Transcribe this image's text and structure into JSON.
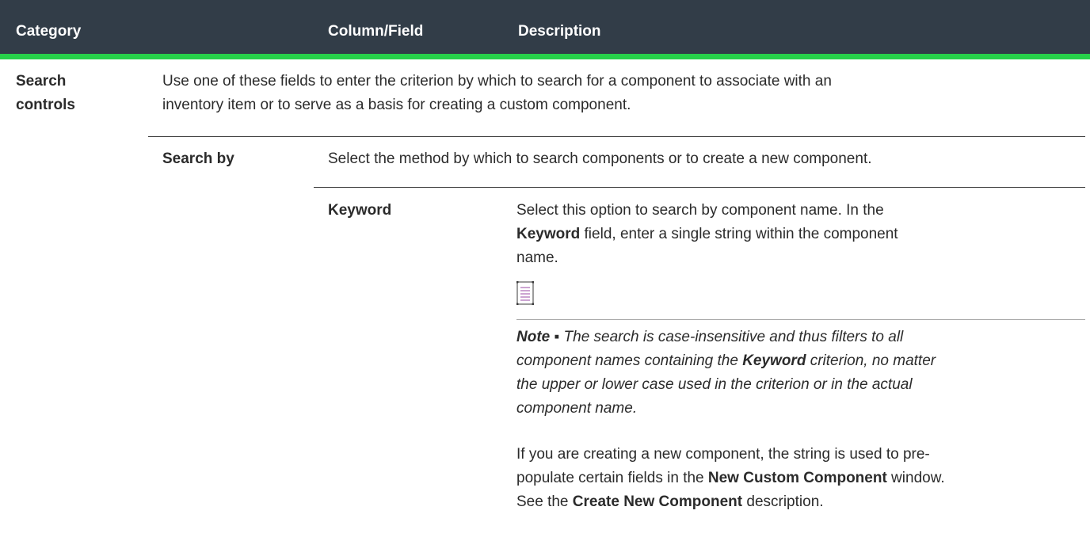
{
  "header": {
    "category": "Category",
    "column_field": "Column/Field",
    "description": "Description"
  },
  "row": {
    "category_line1": "Search",
    "category_line2": "controls",
    "description_line1": "Use one of these fields to enter the criterion by which to search for a component to associate with an",
    "description_line2": "inventory item or to serve as a basis for creating a custom component."
  },
  "search_by": {
    "label": "Search by",
    "description": "Select the method by which to search components or to create a new component."
  },
  "keyword": {
    "label": "Keyword",
    "desc_line1": "Select this option to search by component name. In the",
    "desc_line2_bold": "Keyword",
    "desc_line2_rest": " field, enter a single string within the component",
    "desc_line3": "name.",
    "note_icon": "note-icon",
    "note_prefix": "Note ▪",
    "note_line1_rest": " The search is case-insensitive and thus filters to all",
    "note_line2_a": "component names containing the ",
    "note_line2_bold": "Keyword",
    "note_line2_b": " criterion, no matter",
    "note_line3": "the upper or lower case used in the criterion or in the actual",
    "note_line4": "component name.",
    "para_line1": "If you are creating a new component, the string is used to pre-",
    "para_line2_a": "populate certain fields in the ",
    "para_line2_bold": "New Custom Component",
    "para_line2_b": " window.",
    "para_line3_a": "See the ",
    "para_line3_bold": "Create New Component",
    "para_line3_b": " description."
  }
}
